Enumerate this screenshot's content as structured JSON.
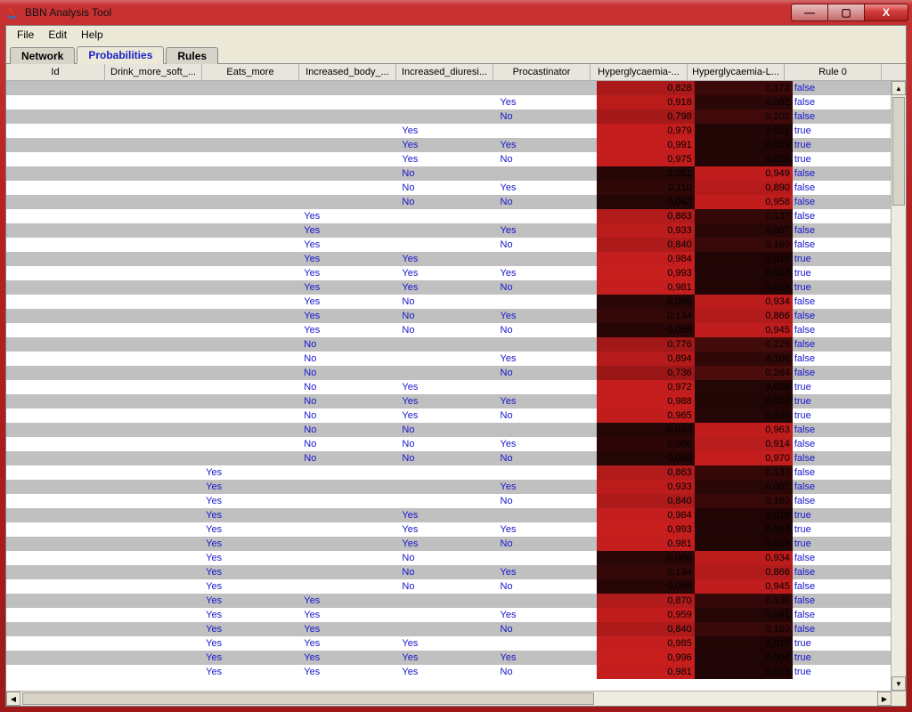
{
  "window": {
    "title": "BBN Analysis Tool"
  },
  "win_buttons": {
    "min": "—",
    "max": "▢",
    "close": "X"
  },
  "menu": {
    "file": "File",
    "edit": "Edit",
    "help": "Help"
  },
  "tabs": {
    "network": "Network",
    "probabilities": "Probabilities",
    "rules": "Rules"
  },
  "columns": [
    "Id",
    "Drink_more_soft_...",
    "Eats_more",
    "Increased_body_...",
    "Increased_diuresi...",
    "Procastinator",
    "Hyperglycaemia-...",
    "Hyperglycaemia-L...",
    "Rule 0"
  ],
  "rows": [
    {
      "c": [
        "",
        "",
        "",
        "",
        "",
        ""
      ],
      "h": "0,828",
      "l": "0,172",
      "r": "false"
    },
    {
      "c": [
        "",
        "",
        "",
        "",
        "",
        "Yes"
      ],
      "h": "0,918",
      "l": "0,082",
      "r": "false"
    },
    {
      "c": [
        "",
        "",
        "",
        "",
        "",
        "No"
      ],
      "h": "0,798",
      "l": "0,202",
      "r": "false"
    },
    {
      "c": [
        "",
        "",
        "",
        "",
        "Yes",
        ""
      ],
      "h": "0,979",
      "l": "0,021",
      "r": "true"
    },
    {
      "c": [
        "",
        "",
        "",
        "",
        "Yes",
        "Yes"
      ],
      "h": "0,991",
      "l": "0,009",
      "r": "true"
    },
    {
      "c": [
        "",
        "",
        "",
        "",
        "Yes",
        "No"
      ],
      "h": "0,975",
      "l": "0,025",
      "r": "true"
    },
    {
      "c": [
        "",
        "",
        "",
        "",
        "No",
        ""
      ],
      "h": "0,051",
      "l": "0,949",
      "r": "false"
    },
    {
      "c": [
        "",
        "",
        "",
        "",
        "No",
        "Yes"
      ],
      "h": "0,110",
      "l": "0,890",
      "r": "false"
    },
    {
      "c": [
        "",
        "",
        "",
        "",
        "No",
        "No"
      ],
      "h": "0,042",
      "l": "0,958",
      "r": "false"
    },
    {
      "c": [
        "",
        "",
        "",
        "Yes",
        "",
        ""
      ],
      "h": "0,863",
      "l": "0,137",
      "r": "false"
    },
    {
      "c": [
        "",
        "",
        "",
        "Yes",
        "",
        "Yes"
      ],
      "h": "0,933",
      "l": "0,067",
      "r": "false"
    },
    {
      "c": [
        "",
        "",
        "",
        "Yes",
        "",
        "No"
      ],
      "h": "0,840",
      "l": "0,160",
      "r": "false"
    },
    {
      "c": [
        "",
        "",
        "",
        "Yes",
        "Yes",
        ""
      ],
      "h": "0,984",
      "l": "0,016",
      "r": "true"
    },
    {
      "c": [
        "",
        "",
        "",
        "Yes",
        "Yes",
        "Yes"
      ],
      "h": "0,993",
      "l": "0,007",
      "r": "true"
    },
    {
      "c": [
        "",
        "",
        "",
        "Yes",
        "Yes",
        "No"
      ],
      "h": "0,981",
      "l": "0,019",
      "r": "true"
    },
    {
      "c": [
        "",
        "",
        "",
        "Yes",
        "No",
        ""
      ],
      "h": "0,066",
      "l": "0,934",
      "r": "false"
    },
    {
      "c": [
        "",
        "",
        "",
        "Yes",
        "No",
        "Yes"
      ],
      "h": "0,134",
      "l": "0,866",
      "r": "false"
    },
    {
      "c": [
        "",
        "",
        "",
        "Yes",
        "No",
        "No"
      ],
      "h": "0,055",
      "l": "0,945",
      "r": "false"
    },
    {
      "c": [
        "",
        "",
        "",
        "No",
        "",
        ""
      ],
      "h": "0,776",
      "l": "0,225",
      "r": "false"
    },
    {
      "c": [
        "",
        "",
        "",
        "No",
        "",
        "Yes"
      ],
      "h": "0,894",
      "l": "0,106",
      "r": "false"
    },
    {
      "c": [
        "",
        "",
        "",
        "No",
        "",
        "No"
      ],
      "h": "0,736",
      "l": "0,264",
      "r": "false"
    },
    {
      "c": [
        "",
        "",
        "",
        "No",
        "Yes",
        ""
      ],
      "h": "0,972",
      "l": "0,028",
      "r": "true"
    },
    {
      "c": [
        "",
        "",
        "",
        "No",
        "Yes",
        "Yes"
      ],
      "h": "0,988",
      "l": "0,012",
      "r": "true"
    },
    {
      "c": [
        "",
        "",
        "",
        "No",
        "Yes",
        "No"
      ],
      "h": "0,965",
      "l": "0,035",
      "r": "true"
    },
    {
      "c": [
        "",
        "",
        "",
        "No",
        "No",
        ""
      ],
      "h": "0,037",
      "l": "0,963",
      "r": "false"
    },
    {
      "c": [
        "",
        "",
        "",
        "No",
        "No",
        "Yes"
      ],
      "h": "0,086",
      "l": "0,914",
      "r": "false"
    },
    {
      "c": [
        "",
        "",
        "",
        "No",
        "No",
        "No"
      ],
      "h": "0,030",
      "l": "0,970",
      "r": "false"
    },
    {
      "c": [
        "",
        "",
        "Yes",
        "",
        "",
        ""
      ],
      "h": "0,863",
      "l": "0,137",
      "r": "false"
    },
    {
      "c": [
        "",
        "",
        "Yes",
        "",
        "",
        "Yes"
      ],
      "h": "0,933",
      "l": "0,067",
      "r": "false"
    },
    {
      "c": [
        "",
        "",
        "Yes",
        "",
        "",
        "No"
      ],
      "h": "0,840",
      "l": "0,160",
      "r": "false"
    },
    {
      "c": [
        "",
        "",
        "Yes",
        "",
        "Yes",
        ""
      ],
      "h": "0,984",
      "l": "0,016",
      "r": "true"
    },
    {
      "c": [
        "",
        "",
        "Yes",
        "",
        "Yes",
        "Yes"
      ],
      "h": "0,993",
      "l": "0,007",
      "r": "true"
    },
    {
      "c": [
        "",
        "",
        "Yes",
        "",
        "Yes",
        "No"
      ],
      "h": "0,981",
      "l": "0,019",
      "r": "true"
    },
    {
      "c": [
        "",
        "",
        "Yes",
        "",
        "No",
        ""
      ],
      "h": "0,066",
      "l": "0,934",
      "r": "false"
    },
    {
      "c": [
        "",
        "",
        "Yes",
        "",
        "No",
        "Yes"
      ],
      "h": "0,134",
      "l": "0,866",
      "r": "false"
    },
    {
      "c": [
        "",
        "",
        "Yes",
        "",
        "No",
        "No"
      ],
      "h": "0,055",
      "l": "0,945",
      "r": "false"
    },
    {
      "c": [
        "",
        "",
        "Yes",
        "Yes",
        "",
        ""
      ],
      "h": "0,870",
      "l": "0,130",
      "r": "false"
    },
    {
      "c": [
        "",
        "",
        "Yes",
        "Yes",
        "",
        "Yes"
      ],
      "h": "0,959",
      "l": "0,041",
      "r": "false"
    },
    {
      "c": [
        "",
        "",
        "Yes",
        "Yes",
        "",
        "No"
      ],
      "h": "0,840",
      "l": "0,160",
      "r": "false"
    },
    {
      "c": [
        "",
        "",
        "Yes",
        "Yes",
        "Yes",
        ""
      ],
      "h": "0,985",
      "l": "0,015",
      "r": "true"
    },
    {
      "c": [
        "",
        "",
        "Yes",
        "Yes",
        "Yes",
        "Yes"
      ],
      "h": "0,996",
      "l": "0,004",
      "r": "true"
    },
    {
      "c": [
        "",
        "",
        "Yes",
        "Yes",
        "Yes",
        "No"
      ],
      "h": "0,981",
      "l": "0,019",
      "r": "true"
    }
  ]
}
